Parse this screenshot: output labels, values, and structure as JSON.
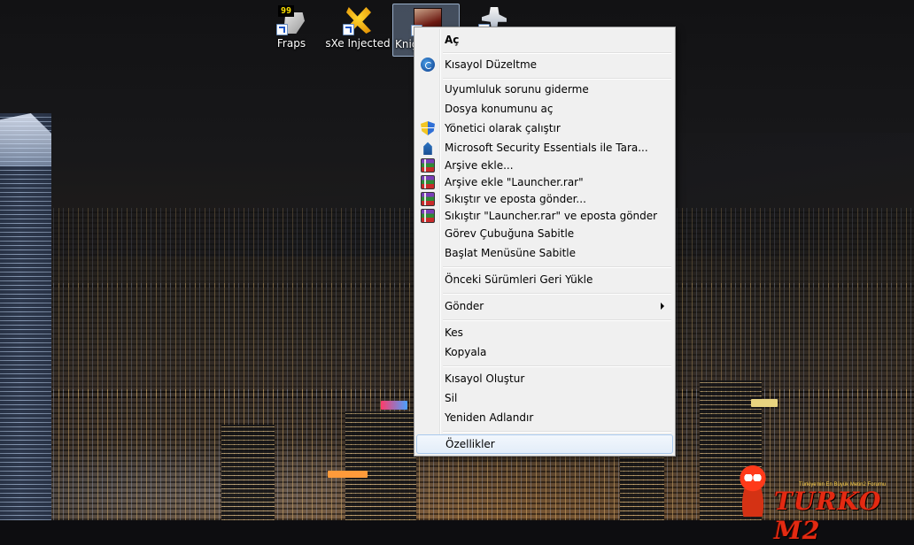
{
  "desktop": {
    "icons": [
      {
        "label": "Fraps",
        "icon": "fraps-icon"
      },
      {
        "label": "sXe Injected",
        "icon": "sxe-injected-icon"
      },
      {
        "label": "Knig",
        "icon": "knight-online-icon",
        "selected": true
      },
      {
        "label": "",
        "icon": "counter-strike-icon"
      }
    ]
  },
  "context_menu": {
    "items": [
      {
        "label": "Aç",
        "bold": true
      },
      {
        "label": "Kısayol Düzeltme",
        "icon": "cc-icon"
      },
      {
        "label": "Uyumluluk sorunu giderme"
      },
      {
        "label": "Dosya konumunu aç"
      },
      {
        "label": "Yönetici olarak çalıştır",
        "icon": "uac-shield-icon"
      },
      {
        "label": "Microsoft Security Essentials ile Tara...",
        "icon": "mse-icon"
      },
      {
        "label": "Arşive ekle...",
        "icon": "winrar-icon"
      },
      {
        "label": "Arşive ekle \"Launcher.rar\"",
        "icon": "winrar-icon"
      },
      {
        "label": "Sıkıştır ve eposta gönder...",
        "icon": "winrar-icon"
      },
      {
        "label": "Sıkıştır \"Launcher.rar\" ve eposta gönder",
        "icon": "winrar-icon"
      },
      {
        "label": "Görev Çubuğuna Sabitle"
      },
      {
        "label": "Başlat Menüsüne Sabitle"
      },
      {
        "label": "Önceki Sürümleri Geri Yükle"
      },
      {
        "label": "Gönder",
        "submenu": true
      },
      {
        "label": "Kes"
      },
      {
        "label": "Kopyala"
      },
      {
        "label": "Kısayol Oluştur"
      },
      {
        "label": "Sil"
      },
      {
        "label": "Yeniden Adlandır"
      },
      {
        "label": "Özellikler",
        "hovered": true
      }
    ]
  },
  "watermark": {
    "brand": "TURKO M2",
    "tagline": "Türkiye'nin En Büyük Metin2 Forumu"
  }
}
